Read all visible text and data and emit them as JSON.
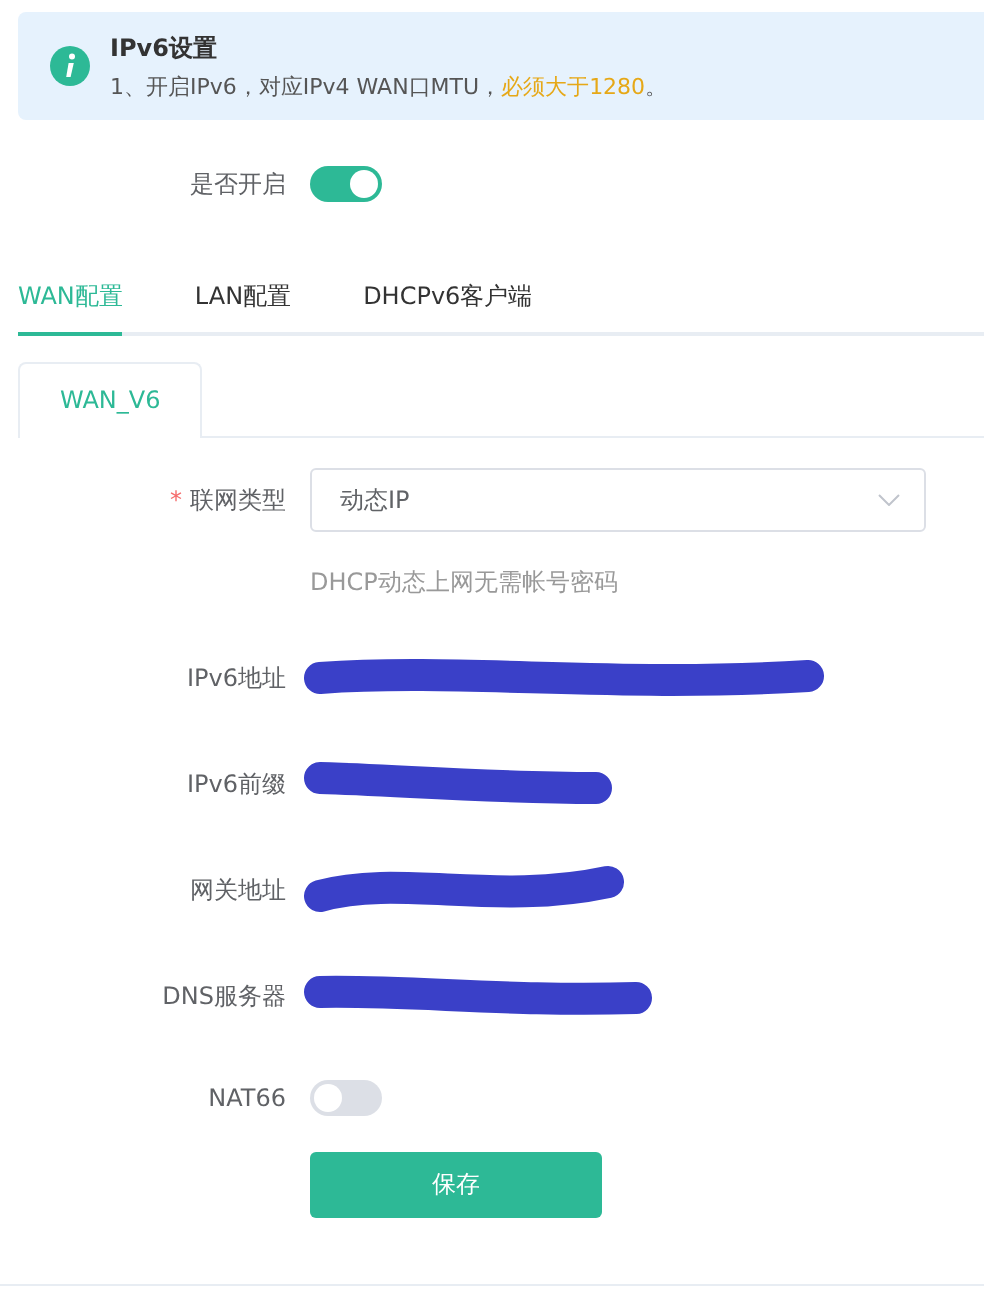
{
  "notice": {
    "title": "IPv6设置",
    "text": "1、开启IPv6，对应IPv4 WAN口MTU，",
    "highlight": "必须大于1280",
    "text_end": "。"
  },
  "enable": {
    "label": "是否开启",
    "on": true
  },
  "tabs": [
    {
      "label": "WAN配置",
      "selected": true
    },
    {
      "label": "LAN配置",
      "selected": false
    },
    {
      "label": "DHCPv6客户端",
      "selected": false
    }
  ],
  "subtabs": [
    {
      "label": "WAN_V6",
      "selected": true
    }
  ],
  "connection_type": {
    "label": "联网类型",
    "required_mark": "*",
    "value": "动态IP",
    "hint": "DHCP动态上网无需帐号密码"
  },
  "fields": [
    {
      "label": "IPv6地址"
    },
    {
      "label": "IPv6前缀"
    },
    {
      "label": "网关地址"
    },
    {
      "label": "DNS服务器"
    }
  ],
  "nat66": {
    "label": "NAT66",
    "on": false
  },
  "save_button": "保存"
}
